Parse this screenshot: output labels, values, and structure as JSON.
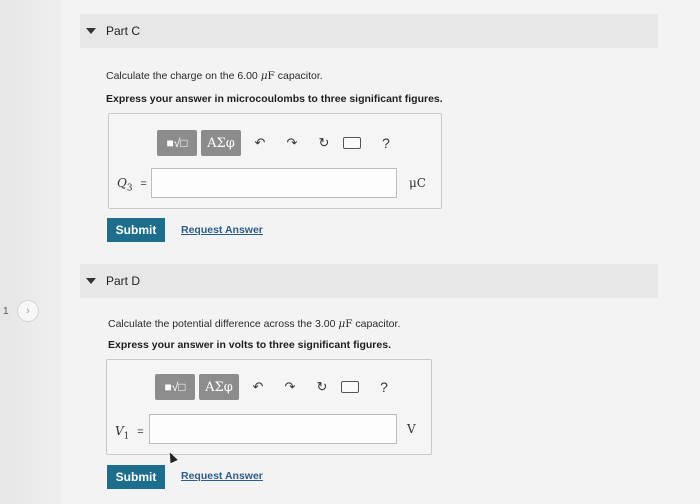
{
  "nav": {
    "page_number": "1",
    "next_symbol": "›"
  },
  "parts": [
    {
      "id": "C",
      "header": "Part C",
      "question_prefix": "Calculate the charge on the 6.00 ",
      "question_mu": "μ",
      "question_unit": "F",
      "question_suffix": " capacitor.",
      "instruction": "Express your answer in microcoulombs to three significant figures.",
      "variable": "Q",
      "variable_sub": "3",
      "equals": "=",
      "input_value": "",
      "unit": "μC",
      "submit_label": "Submit",
      "request_label": "Request Answer"
    },
    {
      "id": "D",
      "header": "Part D",
      "question_prefix": "Calculate the potential difference across the 3.00 ",
      "question_mu": "μ",
      "question_unit": "F",
      "question_suffix": " capacitor.",
      "instruction": "Express your answer in volts to three significant figures.",
      "variable": "V",
      "variable_sub": "1",
      "equals": "=",
      "input_value": "",
      "unit": "V",
      "submit_label": "Submit",
      "request_label": "Request Answer"
    }
  ],
  "toolbar": {
    "templates_label": "■√□",
    "greek_label": "ΑΣφ",
    "undo_symbol": "↶",
    "redo_symbol": "↷",
    "reset_symbol": "↻",
    "help_label": "?"
  },
  "colors": {
    "submit_bg": "#1d6e8c",
    "link": "#2c5c8a",
    "toolbar_btn": "#8c8c8c"
  }
}
